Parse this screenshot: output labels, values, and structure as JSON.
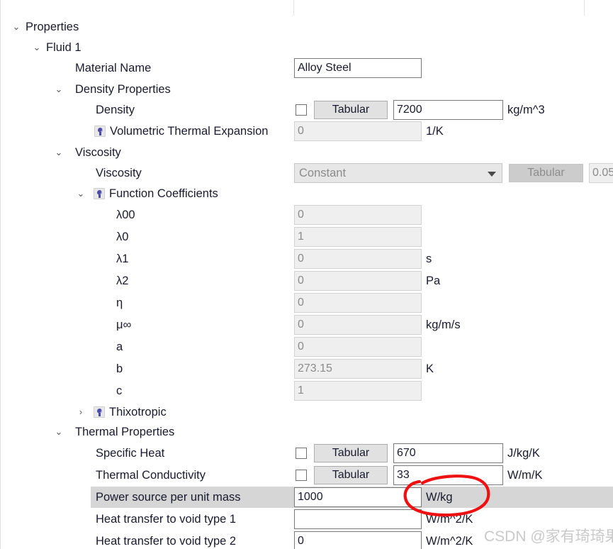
{
  "panel": {
    "title": "Properties",
    "watermark": "CSDN @家有琦琦果"
  },
  "tree": {
    "nodes": [
      {
        "label": "Properties",
        "chevron": "v",
        "indent": 0
      },
      {
        "label": "Fluid 1",
        "chevron": "v",
        "indent": 1
      },
      {
        "label": "Material Name",
        "chevron": "",
        "indent": 3
      },
      {
        "label": "Density Properties",
        "chevron": "v",
        "indent": 2
      },
      {
        "label": "Density",
        "chevron": "",
        "indent": 3
      },
      {
        "label": "Volumetric Thermal Expansion",
        "chevron": "",
        "indent": 4,
        "icon": "function-icon"
      },
      {
        "label": "Viscosity",
        "chevron": "v",
        "indent": 2
      },
      {
        "label": "Viscosity",
        "chevron": "",
        "indent": 3
      },
      {
        "label": "Function Coefficients",
        "chevron": "v",
        "indent": 3,
        "icon": "function-icon"
      },
      {
        "label": "λ00",
        "chevron": "",
        "indent": 5
      },
      {
        "label": "λ0",
        "chevron": "",
        "indent": 5
      },
      {
        "label": "λ1",
        "chevron": "",
        "indent": 5
      },
      {
        "label": "λ2",
        "chevron": "",
        "indent": 5
      },
      {
        "label": "η",
        "chevron": "",
        "indent": 5
      },
      {
        "label": "μ∞",
        "chevron": "",
        "indent": 5
      },
      {
        "label": "a",
        "chevron": "",
        "indent": 5
      },
      {
        "label": "b",
        "chevron": "",
        "indent": 5
      },
      {
        "label": "c",
        "chevron": "",
        "indent": 5
      },
      {
        "label": "Thixotropic",
        "chevron": ">",
        "indent": 3,
        "icon": "function-icon"
      },
      {
        "label": "Thermal Properties",
        "chevron": "v",
        "indent": 2
      },
      {
        "label": "Specific Heat",
        "chevron": "",
        "indent": 3
      },
      {
        "label": "Thermal Conductivity",
        "chevron": "",
        "indent": 3
      },
      {
        "label": "Power source per unit mass",
        "chevron": "",
        "indent": 3,
        "selected": true
      },
      {
        "label": "Heat transfer to void type 1",
        "chevron": "",
        "indent": 3
      },
      {
        "label": "Heat transfer to void type 2",
        "chevron": "",
        "indent": 3
      }
    ]
  },
  "fields": {
    "material_name": {
      "value": "Alloy Steel",
      "unit": ""
    },
    "density": {
      "value": "7200",
      "unit": "kg/m^3",
      "tabular_label": "Tabular",
      "checkbox": false
    },
    "volumetric_thermal_expansion": {
      "value": "0",
      "unit": "1/K"
    },
    "viscosity": {
      "mode": "Constant",
      "tabular_label": "Tabular",
      "value": "0.05"
    },
    "lambda00": {
      "value": "0",
      "unit": ""
    },
    "lambda0": {
      "value": "1",
      "unit": ""
    },
    "lambda1": {
      "value": "0",
      "unit": "s"
    },
    "lambda2": {
      "value": "0",
      "unit": "Pa"
    },
    "eta": {
      "value": "0",
      "unit": ""
    },
    "mu_inf": {
      "value": "0",
      "unit": "kg/m/s"
    },
    "a": {
      "value": "0",
      "unit": ""
    },
    "b": {
      "value": "273.15",
      "unit": "K"
    },
    "c": {
      "value": "1",
      "unit": ""
    },
    "specific_heat": {
      "value": "670",
      "unit": "J/kg/K",
      "tabular_label": "Tabular",
      "checkbox": false
    },
    "thermal_conductivity": {
      "value": "33",
      "unit": "W/m/K",
      "tabular_label": "Tabular",
      "checkbox": false
    },
    "power_source_per_unit_mass": {
      "value": "1000",
      "unit": "W/kg"
    },
    "heat_transfer_void_1": {
      "value": "",
      "unit": "W/m^2/K"
    },
    "heat_transfer_void_2": {
      "value": "0",
      "unit": "W/m^2/K"
    }
  },
  "annotation": {
    "color": "#ee1111",
    "target": "W/kg"
  }
}
